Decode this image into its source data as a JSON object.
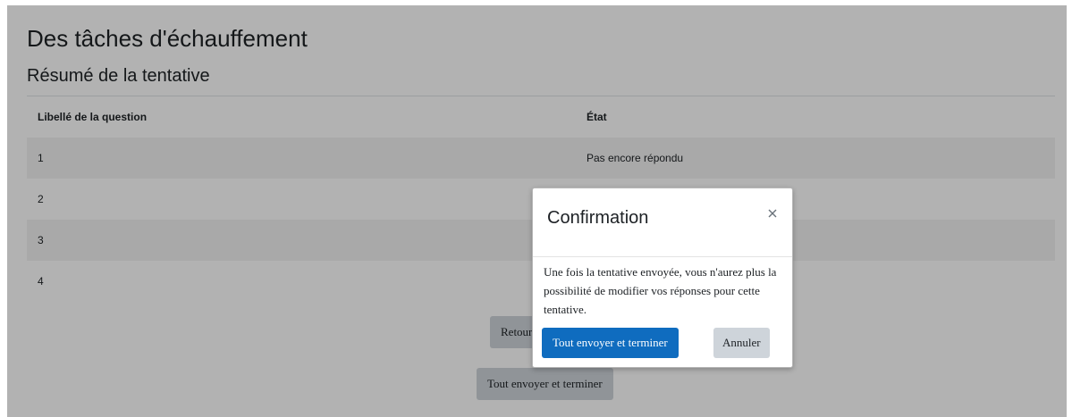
{
  "page": {
    "title": "Des tâches d'échauffement",
    "section_title": "Résumé de la tentative"
  },
  "table": {
    "headers": [
      "Libellé de la question",
      "État"
    ],
    "rows": [
      {
        "question": "1",
        "status": "Pas encore répondu"
      },
      {
        "question": "2",
        "status": ""
      },
      {
        "question": "3",
        "status": ""
      },
      {
        "question": "4",
        "status": ""
      }
    ]
  },
  "buttons": {
    "return_label": "Retour à",
    "submit_all_label": "Tout envoyer et terminer"
  },
  "modal": {
    "title": "Confirmation",
    "body": "Une fois la tentative envoyée, vous n'aurez plus la possibilité de modifier vos réponses pour cette tentative.",
    "submit_label": "Tout envoyer et terminer",
    "cancel_label": "Annuler",
    "close_icon": "close-icon"
  },
  "colors": {
    "primary": "#0f6cbf",
    "secondary": "#ced4da",
    "stripe": "#f2f2f2"
  }
}
